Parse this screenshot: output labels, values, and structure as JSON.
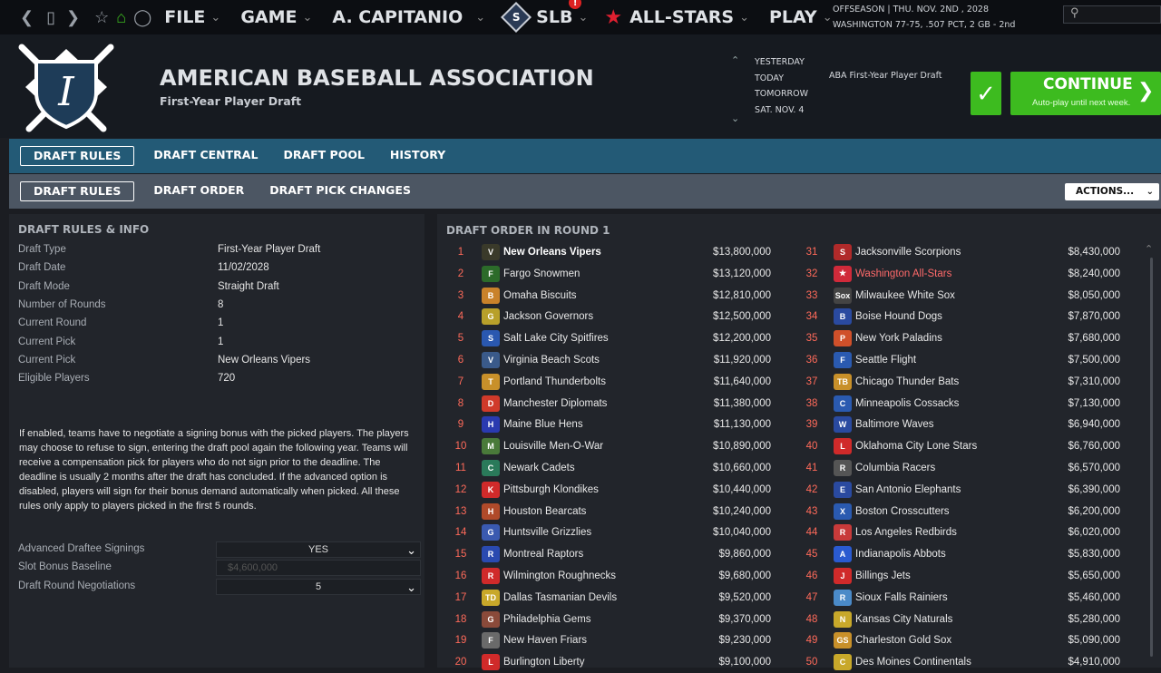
{
  "topbar": {
    "menus": [
      {
        "label": "FILE"
      },
      {
        "label": "GAME"
      },
      {
        "label": "A. CAPITANIO"
      },
      {
        "label": "SLB"
      },
      {
        "label": "ALL-STARS"
      },
      {
        "label": "PLAY"
      }
    ],
    "slb_badge": "S",
    "notif_badge": "!",
    "status_line1": "OFFSEASON  |  THU. NOV. 2ND , 2028",
    "status_line2": "WASHINGTON  77-75, .507 PCT, 2 GB - 2nd"
  },
  "header": {
    "org_title": "AMERICAN BASEBALL ASSOCIATION",
    "org_subtitle": "First-Year Player Draft",
    "logo_letter": "I",
    "dates": [
      "YESTERDAY",
      "TODAY",
      "TOMORROW",
      "SAT. NOV. 4"
    ],
    "event": "ABA First-Year Player Draft",
    "continue_label": "CONTINUE",
    "continue_sub": "Auto-play until next week."
  },
  "tabs_primary": [
    "DRAFT RULES",
    "DRAFT CENTRAL",
    "DRAFT POOL",
    "HISTORY"
  ],
  "tabs_secondary": [
    "DRAFT RULES",
    "DRAFT ORDER",
    "DRAFT PICK CHANGES"
  ],
  "actions_label": "ACTIONS...",
  "rules": {
    "title": "DRAFT RULES & INFO",
    "rows": [
      {
        "k": "Draft Type",
        "v": "First-Year Player Draft"
      },
      {
        "k": "Draft Date",
        "v": "11/02/2028"
      },
      {
        "k": "Draft Mode",
        "v": "Straight Draft"
      },
      {
        "k": "Number of Rounds",
        "v": "8"
      },
      {
        "k": "Current Round",
        "v": "1"
      },
      {
        "k": "Current Pick",
        "v": "1"
      },
      {
        "k": "Current Pick",
        "v": "New Orleans Vipers"
      },
      {
        "k": "Eligible Players",
        "v": "720"
      }
    ],
    "description": "If enabled, teams have to negotiate a signing bonus with the picked players. The players may choose to refuse to sign, entering the draft pool again the following year. Teams will receive a compensation pick for players who do not sign prior to the deadline. The deadline is usually 2 months after the draft has concluded. If the advanced option is disabled, players will sign for their bonus demand automatically when picked. All these rules only apply to players picked in the first 5 rounds.",
    "settings": [
      {
        "k": "Advanced Draftee Signings",
        "v": "YES"
      },
      {
        "k": "Slot Bonus Baseline",
        "v": "$4,600,000"
      },
      {
        "k": "Draft Round Negotiations",
        "v": "5"
      }
    ]
  },
  "order": {
    "title": "DRAFT ORDER IN ROUND 1",
    "left": [
      {
        "n": "1",
        "team": "New Orleans Vipers",
        "amt": "$13,800,000",
        "logo": "V",
        "color": "#3a3a2a"
      },
      {
        "n": "2",
        "team": "Fargo Snowmen",
        "amt": "$13,120,000",
        "logo": "F",
        "color": "#2c6b2a"
      },
      {
        "n": "3",
        "team": "Omaha Biscuits",
        "amt": "$12,810,000",
        "logo": "B",
        "color": "#c9822a"
      },
      {
        "n": "4",
        "team": "Jackson Governors",
        "amt": "$12,500,000",
        "logo": "G",
        "color": "#b8a02a"
      },
      {
        "n": "5",
        "team": "Salt Lake City Spitfires",
        "amt": "$12,200,000",
        "logo": "S",
        "color": "#2a58b0"
      },
      {
        "n": "6",
        "team": "Virginia Beach Scots",
        "amt": "$11,920,000",
        "logo": "V",
        "color": "#3a5a8a"
      },
      {
        "n": "7",
        "team": "Portland Thunderbolts",
        "amt": "$11,640,000",
        "logo": "T",
        "color": "#c8902a"
      },
      {
        "n": "8",
        "team": "Manchester Diplomats",
        "amt": "$11,380,000",
        "logo": "D",
        "color": "#d03a2a"
      },
      {
        "n": "9",
        "team": "Maine Blue Hens",
        "amt": "$11,130,000",
        "logo": "H",
        "color": "#2a3ab0"
      },
      {
        "n": "10",
        "team": "Louisville Men-O-War",
        "amt": "$10,890,000",
        "logo": "M",
        "color": "#4a7a3a"
      },
      {
        "n": "11",
        "team": "Newark Cadets",
        "amt": "$10,660,000",
        "logo": "C",
        "color": "#2a7a5a"
      },
      {
        "n": "12",
        "team": "Pittsburgh Klondikes",
        "amt": "$10,440,000",
        "logo": "K",
        "color": "#d02a2a"
      },
      {
        "n": "13",
        "team": "Houston Bearcats",
        "amt": "$10,240,000",
        "logo": "H",
        "color": "#b04a2a"
      },
      {
        "n": "14",
        "team": "Huntsville Grizzlies",
        "amt": "$10,040,000",
        "logo": "G",
        "color": "#3a5ab0"
      },
      {
        "n": "15",
        "team": "Montreal Raptors",
        "amt": "$9,860,000",
        "logo": "R",
        "color": "#2a4ab0"
      },
      {
        "n": "16",
        "team": "Wilmington Roughnecks",
        "amt": "$9,680,000",
        "logo": "R",
        "color": "#d02a2a"
      },
      {
        "n": "17",
        "team": "Dallas Tasmanian Devils",
        "amt": "$9,520,000",
        "logo": "TD",
        "color": "#c8a82a"
      },
      {
        "n": "18",
        "team": "Philadelphia Gems",
        "amt": "$9,370,000",
        "logo": "G",
        "color": "#8a4a3a"
      },
      {
        "n": "19",
        "team": "New Haven Friars",
        "amt": "$9,230,000",
        "logo": "F",
        "color": "#6a6a6a"
      },
      {
        "n": "20",
        "team": "Burlington Liberty",
        "amt": "$9,100,000",
        "logo": "L",
        "color": "#d02a2a"
      }
    ],
    "right": [
      {
        "n": "31",
        "team": "Jacksonville Scorpions",
        "amt": "$8,430,000",
        "logo": "S",
        "color": "#b02a2a"
      },
      {
        "n": "32",
        "team": "Washington All-Stars",
        "amt": "$8,240,000",
        "logo": "★",
        "color": "#d02a3a"
      },
      {
        "n": "33",
        "team": "Milwaukee White Sox",
        "amt": "$8,050,000",
        "logo": "Sox",
        "color": "#444"
      },
      {
        "n": "34",
        "team": "Boise Hound Dogs",
        "amt": "$7,870,000",
        "logo": "B",
        "color": "#2a4aa0"
      },
      {
        "n": "35",
        "team": "New York Paladins",
        "amt": "$7,680,000",
        "logo": "P",
        "color": "#d0502a"
      },
      {
        "n": "36",
        "team": "Seattle Flight",
        "amt": "$7,500,000",
        "logo": "F",
        "color": "#2a5ab0"
      },
      {
        "n": "37",
        "team": "Chicago Thunder Bats",
        "amt": "$7,310,000",
        "logo": "TB",
        "color": "#c8902a"
      },
      {
        "n": "38",
        "team": "Minneapolis Cossacks",
        "amt": "$7,130,000",
        "logo": "C",
        "color": "#2a5ab0"
      },
      {
        "n": "39",
        "team": "Baltimore Waves",
        "amt": "$6,940,000",
        "logo": "W",
        "color": "#2a4aa0"
      },
      {
        "n": "40",
        "team": "Oklahoma City Lone Stars",
        "amt": "$6,760,000",
        "logo": "L",
        "color": "#d02a2a"
      },
      {
        "n": "41",
        "team": "Columbia Racers",
        "amt": "$6,570,000",
        "logo": "R",
        "color": "#555"
      },
      {
        "n": "42",
        "team": "San Antonio Elephants",
        "amt": "$6,390,000",
        "logo": "E",
        "color": "#2a4aa0"
      },
      {
        "n": "43",
        "team": "Boston Crosscutters",
        "amt": "$6,200,000",
        "logo": "X",
        "color": "#2a5ab0"
      },
      {
        "n": "44",
        "team": "Los Angeles Redbirds",
        "amt": "$6,020,000",
        "logo": "R",
        "color": "#c83a3a"
      },
      {
        "n": "45",
        "team": "Indianapolis Abbots",
        "amt": "$5,830,000",
        "logo": "A",
        "color": "#2a5ad0"
      },
      {
        "n": "46",
        "team": "Billings Jets",
        "amt": "$5,650,000",
        "logo": "J",
        "color": "#d02a2a"
      },
      {
        "n": "47",
        "team": "Sioux Falls Rainiers",
        "amt": "$5,460,000",
        "logo": "R",
        "color": "#4a8ac8"
      },
      {
        "n": "48",
        "team": "Kansas City Naturals",
        "amt": "$5,280,000",
        "logo": "N",
        "color": "#c8a82a"
      },
      {
        "n": "49",
        "team": "Charleston Gold Sox",
        "amt": "$5,090,000",
        "logo": "GS",
        "color": "#c8902a"
      },
      {
        "n": "50",
        "team": "Des Moines Continentals",
        "amt": "$4,910,000",
        "logo": "C",
        "color": "#c8a82a"
      }
    ]
  }
}
